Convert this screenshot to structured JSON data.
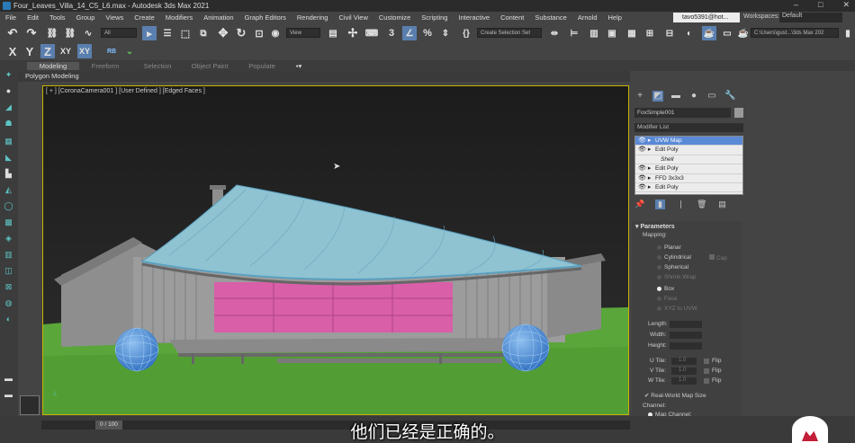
{
  "window": {
    "title": "Four_Leaves_Villa_14_C5_L6.max - Autodesk 3ds Max 2021",
    "controls": [
      "–",
      "□",
      "✕"
    ]
  },
  "menubar": {
    "items": [
      "File",
      "Edit",
      "Tools",
      "Group",
      "Views",
      "Create",
      "Modifiers",
      "Animation",
      "Graph Editors",
      "Rendering",
      "Civil View",
      "Customize",
      "Scripting",
      "Interactive",
      "Content",
      "Substance",
      "Arnold",
      "Help"
    ],
    "user": "tavo5391@hot...",
    "workspaces_label": "Workspaces:",
    "workspace_value": "Default"
  },
  "toolbar": {
    "selection_filter": "All",
    "ref_coord": "View",
    "named_selection": "Create Selection Set",
    "project_path": "C:\\Users\\gust...\\3ds Max 202",
    "axis_x": "X",
    "axis_y": "Y",
    "axis_z": "Z",
    "axis_xy": "XY",
    "axis_xy2": "XY",
    "rb_label": "RB"
  },
  "ribbon": {
    "tabs": [
      "Modeling",
      "Freeform",
      "Selection",
      "Object Paint",
      "Populate"
    ],
    "active_tab": "Modeling",
    "sub_label": "Polygon Modeling"
  },
  "viewport": {
    "label": "[ + ] [CoronaCamera001 ] [User Defined ] [Edged Faces ]",
    "colors": {
      "sky": "#1a1a1a",
      "grass": "#5aa63a",
      "roof": "#8fc3d2",
      "walls": "#9a9a9a",
      "pink_panel": "#d85fa8",
      "spheres": "#4f8fd9",
      "border": "#c8b400"
    }
  },
  "command_panel": {
    "object_name": "FoxSimple001",
    "modifier_list_label": "Modifier List",
    "stack": [
      {
        "label": "UVW Map",
        "selected": true
      },
      {
        "label": "Edit Poly",
        "selected": false
      },
      {
        "label": "Shell",
        "selected": false,
        "italic": true
      },
      {
        "label": "Edit Poly",
        "selected": false
      },
      {
        "label": "FFD 3x3x3",
        "selected": false
      },
      {
        "label": "Edit Poly",
        "selected": false
      }
    ],
    "parameters": {
      "header": "Parameters",
      "mapping_label": "Mapping:",
      "mapping_options": [
        "Planar",
        "Cylindrical",
        "Spherical",
        "Shrink Wrap",
        "Box",
        "Face",
        "XYZ to UVW"
      ],
      "cap_label": "Cap",
      "selected_option": "Box",
      "length_label": "Length:",
      "width_label": "Width:",
      "height_label": "Height:",
      "utile_label": "U Tile:",
      "vtile_label": "V Tile:",
      "wtile_label": "W Tile:",
      "tile_value": "1.0",
      "flip_label": "Flip",
      "real_world_label": "Real-World Map Size",
      "channel_label": "Channel:",
      "map_channel_label": "Map Channel:"
    }
  },
  "timeline": {
    "frame": "0 / 100"
  },
  "subtitle": "他们已经是正确的。"
}
